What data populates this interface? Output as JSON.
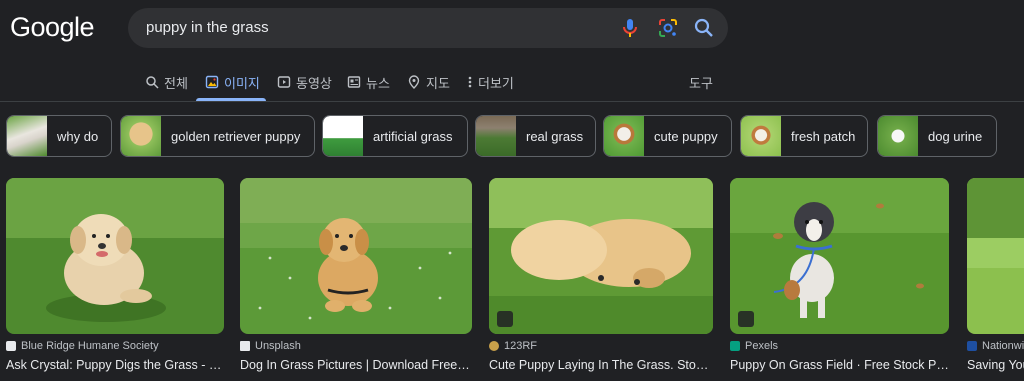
{
  "logo": "Google",
  "search": {
    "query": "puppy in the grass"
  },
  "tabs": [
    {
      "label": "전체",
      "icon": "search-icon"
    },
    {
      "label": "이미지",
      "icon": "image-icon",
      "active": true
    },
    {
      "label": "동영상",
      "icon": "play-icon"
    },
    {
      "label": "뉴스",
      "icon": "news-icon"
    },
    {
      "label": "지도",
      "icon": "map-pin-icon"
    },
    {
      "label": "더보기",
      "icon": "more-vert-icon"
    }
  ],
  "tools_label": "도구",
  "chips": [
    {
      "label": "why do"
    },
    {
      "label": "golden retriever puppy"
    },
    {
      "label": "artificial grass"
    },
    {
      "label": "real grass"
    },
    {
      "label": "cute puppy"
    },
    {
      "label": "fresh patch"
    },
    {
      "label": "dog urine"
    }
  ],
  "results": [
    {
      "source": "Blue Ridge Humane Society",
      "title": "Ask Crystal: Puppy Digs the Grass - Bl..."
    },
    {
      "source": "Unsplash",
      "title": "Dog In Grass Pictures | Download Free Im..."
    },
    {
      "source": "123RF",
      "title": "Cute Puppy Laying In The Grass. Stock ..."
    },
    {
      "source": "Pexels",
      "title": "Puppy On Grass Field · Free Stock Photo"
    },
    {
      "source": "Nationwi",
      "title": "Saving You"
    }
  ],
  "colors": {
    "background": "#202124",
    "accent": "#8ab4f8",
    "searchbox": "#303134",
    "grass": "#5e9a3a"
  }
}
